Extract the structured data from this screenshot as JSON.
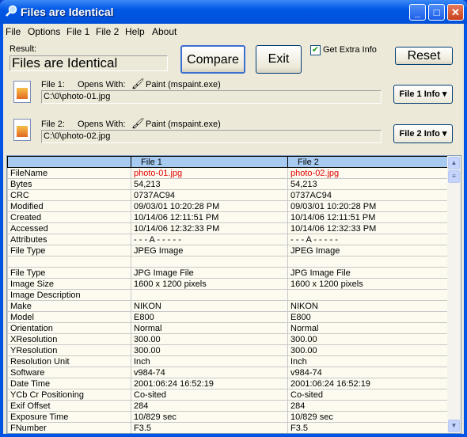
{
  "window": {
    "title": "Files are Identical",
    "minimize": "_",
    "maximize": "□",
    "close": "✕"
  },
  "menu": [
    "File",
    "Options",
    "File 1",
    "File 2",
    "Help",
    "About"
  ],
  "result": {
    "label": "Result:",
    "value": "Files are Identical"
  },
  "buttons": {
    "compare": "Compare",
    "exit": "Exit",
    "reset": "Reset",
    "file1_info": "File 1 Info ▾",
    "file2_info": "File 2 Info ▾"
  },
  "extra_info": {
    "label": "Get Extra Info",
    "checked": true
  },
  "file1": {
    "label": "File 1:",
    "opens_with_label": "Opens With:",
    "app": "Paint (mspaint.exe)",
    "path": "C:\\0\\photo-01.jpg"
  },
  "file2": {
    "label": "File 2:",
    "opens_with_label": "Opens With:",
    "app": "Paint (mspaint.exe)",
    "path": "C:\\0\\photo-02.jpg"
  },
  "table": {
    "headers": [
      "",
      "File 1",
      "File 2"
    ],
    "rows": [
      [
        "FileName",
        "photo-01.jpg",
        "photo-02.jpg"
      ],
      [
        "Bytes",
        "54,213",
        "54,213"
      ],
      [
        "CRC",
        "0737AC94",
        "0737AC94"
      ],
      [
        "Modified",
        "09/03/01  10:20:28  PM",
        "09/03/01  10:20:28  PM"
      ],
      [
        "Created",
        "10/14/06  12:11:51  PM",
        "10/14/06  12:11:51  PM"
      ],
      [
        "Accessed",
        "10/14/06  12:32:33  PM",
        "10/14/06  12:32:33  PM"
      ],
      [
        "Attributes",
        "- - - A - - - - -",
        "- - - A - - - - -"
      ],
      [
        "File Type",
        "JPEG Image",
        "JPEG Image"
      ],
      [
        "",
        "",
        ""
      ],
      [
        "File Type",
        "JPG Image File",
        "JPG Image File"
      ],
      [
        "Image Size",
        "1600 x 1200 pixels",
        "1600 x 1200 pixels"
      ],
      [
        "Image Description",
        "",
        ""
      ],
      [
        "Make",
        "NIKON",
        "NIKON"
      ],
      [
        "Model",
        "E800",
        "E800"
      ],
      [
        "Orientation",
        "Normal",
        "Normal"
      ],
      [
        "XResolution",
        "300.00",
        "300.00"
      ],
      [
        "YResolution",
        "300.00",
        "300.00"
      ],
      [
        "Resolution Unit",
        "Inch",
        "Inch"
      ],
      [
        "Software",
        "v984-74",
        "v984-74"
      ],
      [
        "Date Time",
        "2001:06:24 16:52:19",
        "2001:06:24 16:52:19"
      ],
      [
        "YCb Cr Positioning",
        "Co-sited",
        "Co-sited"
      ],
      [
        "Exif Offset",
        "284",
        "284"
      ],
      [
        "Exposure Time",
        "10/829 sec",
        "10/829 sec"
      ],
      [
        "FNumber",
        "F3.5",
        "F3.5"
      ]
    ]
  },
  "colors": {
    "header_bg": "#a6caf0",
    "highlight": "#e00000",
    "grid_bg": "#fdfbf0"
  }
}
